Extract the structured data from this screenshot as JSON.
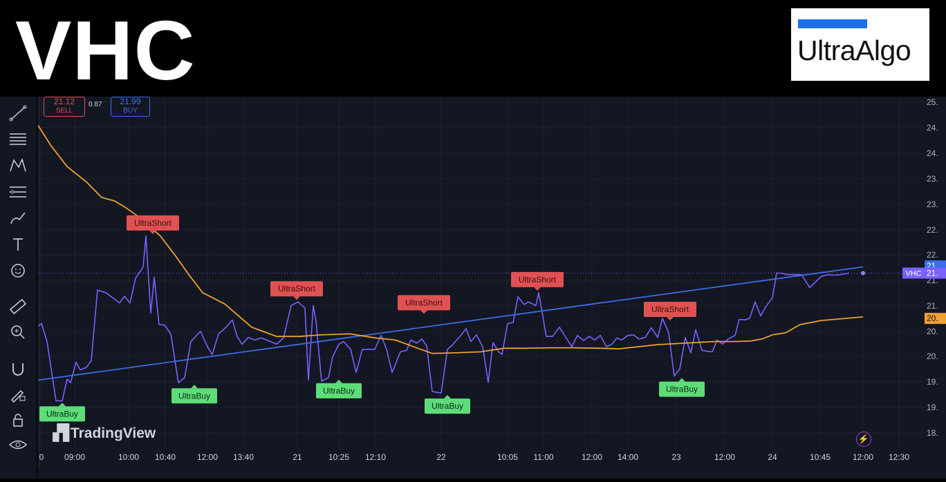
{
  "banner": {
    "ticker": "VHC",
    "logo_text": "UltraAlgo",
    "logo_accent": "#1e6ff0"
  },
  "order_panel": {
    "sell_price": "21.12",
    "sell_label": "SELL",
    "spread": "0.87",
    "buy_price": "21.99",
    "buy_label": "BUY"
  },
  "watermark": {
    "text": "TradingView"
  },
  "colors": {
    "background": "#131722",
    "price_line": "#7b61ff",
    "slow_ma": "#3b6ee8",
    "fast_ma": "#f0a030",
    "short_label": "#e05252",
    "buy_label": "#5ddc78"
  },
  "chart_data": {
    "type": "line",
    "symbol": "VHC",
    "x_tick_labels": [
      "0",
      "09:00",
      "10:00",
      "10:40",
      "12:00",
      "13:40",
      "21",
      "10:25",
      "12:10",
      "22",
      "10:05",
      "11:00",
      "12:00",
      "14:00",
      "23",
      "12:00",
      "24",
      "10:45",
      "12:00",
      "12:30"
    ],
    "y_tick_labels": [
      "25.",
      "24.",
      "24.",
      "23.",
      "23.",
      "22.",
      "22.",
      "21.",
      "21.",
      "20.",
      "20.",
      "19.",
      "19.",
      "18."
    ],
    "ylim": [
      18.4,
      25.0
    ],
    "last_price_tags": [
      {
        "text": "21.",
        "value": 21.82,
        "color": "#3b6ee8"
      },
      {
        "text": "21.",
        "value": 21.68,
        "color": "#7b61ff"
      },
      {
        "text": "20.",
        "value": 20.8,
        "color": "#f0a030"
      }
    ],
    "last_price_label": "VHC",
    "series": [
      {
        "key": "price",
        "color": "#7b61ff",
        "values": [
          20.65,
          20.7,
          20.35,
          19.2,
          19.2,
          19.62,
          19.55,
          19.95,
          19.8,
          19.85,
          19.98,
          21.35,
          21.3,
          21.2,
          21.1,
          21.23,
          21.1,
          21.58,
          21.8,
          22.4,
          20.9,
          21.6,
          20.68,
          20.67,
          20.5,
          19.55,
          19.65,
          20.35,
          20.55,
          20.25,
          20.1,
          20.5,
          20.63,
          20.77,
          20.45,
          20.3,
          20.43,
          20.38,
          20.42,
          20.35,
          20.3,
          20.42,
          21.05,
          21.12,
          21.0,
          19.6,
          21.05,
          20.75,
          19.58,
          19.65,
          20.05,
          20.3,
          20.35,
          20.2,
          19.75,
          20.2,
          20.2,
          20.2,
          20.47,
          20.2,
          19.75,
          20.15,
          20.18,
          20.38,
          20.32,
          20.4,
          20.27,
          19.38,
          19.35,
          20.2,
          20.28,
          20.45,
          20.6,
          20.35,
          20.48,
          20.25,
          19.56,
          20.33,
          20.15,
          20.1,
          20.7,
          20.72,
          21.22,
          21.07,
          21.12,
          21.05,
          21.3,
          20.45,
          20.45,
          20.63,
          20.5,
          20.25,
          20.47,
          20.37,
          20.45,
          20.38,
          20.47,
          20.25,
          20.3,
          20.42,
          20.38,
          20.47,
          20.48,
          20.4,
          20.43,
          20.62,
          20.43,
          20.8,
          20.52,
          19.68,
          19.82,
          20.43,
          20.13,
          20.58,
          20.18,
          20.16,
          20.15,
          20.38,
          20.3,
          20.4,
          20.47,
          20.78,
          20.77,
          20.8,
          21.12,
          20.85,
          21.02,
          21.2,
          21.68,
          21.68,
          21.65,
          21.65,
          21.65,
          21.4,
          21.62,
          21.65,
          21.64,
          21.65,
          21.68
        ]
      },
      {
        "key": "slow",
        "color": "#3b6ee8",
        "values": [
          19.6,
          21.8
        ]
      },
      {
        "key": "fast",
        "color": "#f0a030",
        "values": [
          24.55,
          24.17,
          23.75,
          23.45,
          23.15,
          23.08,
          22.95,
          22.75,
          22.4,
          22.03,
          21.65,
          21.3,
          21.08,
          20.63,
          20.45,
          20.45,
          20.48,
          20.5,
          20.42,
          20.38,
          20.22,
          20.12,
          20.13,
          20.15,
          20.22,
          20.22,
          20.23,
          20.23,
          20.22,
          20.21,
          20.25,
          20.29,
          20.31,
          20.33,
          20.35,
          20.35,
          20.36,
          20.4,
          20.48,
          20.52,
          20.68,
          20.76,
          20.83
        ]
      }
    ],
    "signals": [
      {
        "type": "buy",
        "text": "UltraBuy",
        "value": 19.2
      },
      {
        "type": "short",
        "text": "UltraShort",
        "value": 22.4
      },
      {
        "type": "buy",
        "text": "UltraBuy",
        "value": 19.55
      },
      {
        "type": "short",
        "text": "UltraShort",
        "value": 21.12
      },
      {
        "type": "buy",
        "text": "UltraBuy",
        "value": 19.65
      },
      {
        "type": "short",
        "text": "UltraShort",
        "value": 20.85
      },
      {
        "type": "buy",
        "text": "UltraBuy",
        "value": 19.35
      },
      {
        "type": "short",
        "text": "UltraShort",
        "value": 21.3
      },
      {
        "type": "short",
        "text": "UltraShort",
        "value": 20.72
      },
      {
        "type": "buy",
        "text": "UltraBuy",
        "value": 19.68
      }
    ]
  }
}
